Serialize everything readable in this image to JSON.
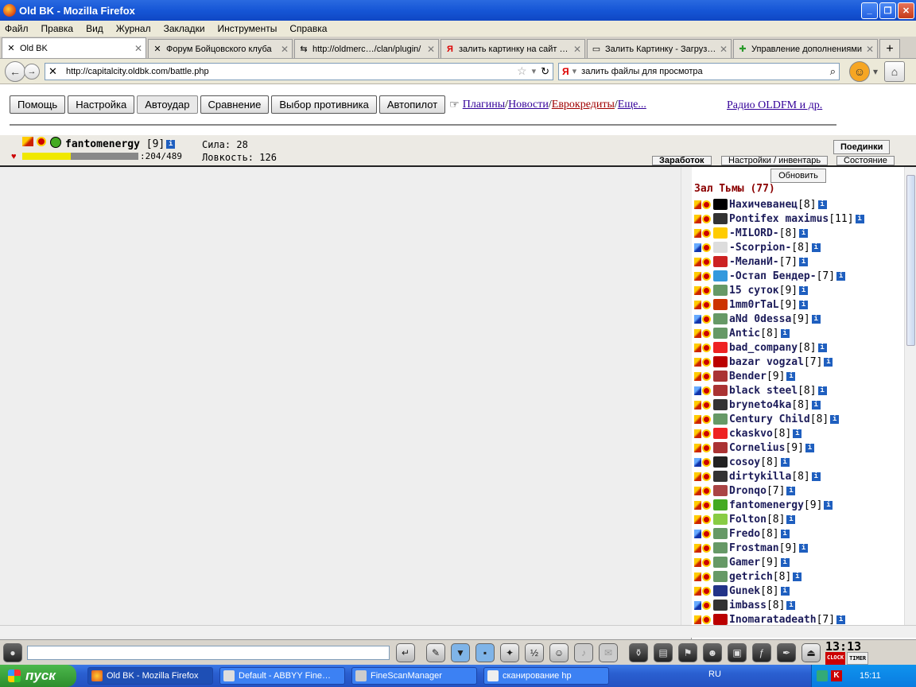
{
  "window": {
    "title": "Old BK - Mozilla Firefox"
  },
  "menu": [
    "Файл",
    "Правка",
    "Вид",
    "Журнал",
    "Закладки",
    "Инструменты",
    "Справка"
  ],
  "tabs": [
    {
      "label": "Old BK",
      "icon": "✕",
      "active": true
    },
    {
      "label": "Форум Бойцовского клуба",
      "icon": "✕",
      "active": false
    },
    {
      "label": "http://oldmerc…/clan/plugin/",
      "icon": "⇆",
      "active": false
    },
    {
      "label": "залить картинку на сайт …",
      "icon": "Я",
      "active": false
    },
    {
      "label": "Залить Картинку - Загруз…",
      "icon": "▭",
      "active": false
    },
    {
      "label": "Управление дополнениями",
      "icon": "✚",
      "active": false
    }
  ],
  "nav": {
    "url": "http://capitalcity.oldbk.com/battle.php",
    "search_value": "залить файлы для просмотра",
    "search_engine": "Я"
  },
  "game": {
    "buttons": [
      "Помощь",
      "Настройка",
      "Автоудар",
      "Сравнение",
      "Выбор противника",
      "Автопилот"
    ],
    "pressed_button": "Автоудар",
    "links": [
      "Плагины",
      "Новости",
      "Еврокредиты",
      "Еще..."
    ],
    "radio": "Радио OLDFM и др.",
    "player": {
      "nick": "fantomenergy",
      "level": "[9]",
      "hp": ":204/489",
      "hp_fraction": 0.42,
      "str": "Сила: 28",
      "agi": "Ловкость: 126"
    },
    "side_buttons": [
      "Поединки",
      "Заработок",
      "Настройки / инвентарь",
      "Состояние"
    ],
    "refresh": "Обновить",
    "room": "Зал Тьмы (77)",
    "users": [
      {
        "name": "Нахичеванец",
        "lvl": "[8]",
        "clan": "#000000"
      },
      {
        "name": "Pontifex maximus",
        "lvl": "[11]",
        "clan": "#333333"
      },
      {
        "name": "-MILORD-",
        "lvl": "[8]",
        "clan": "#ffcc00"
      },
      {
        "name": "-Scorpion-",
        "lvl": "[8]",
        "clan": "#dddddd"
      },
      {
        "name": "-МеланИ-",
        "lvl": "[7]",
        "clan": "#cc2222"
      },
      {
        "name": "-Остап Бендер-",
        "lvl": "[7]",
        "clan": "#3399dd"
      },
      {
        "name": "15 суток",
        "lvl": "[9]",
        "clan": "#669966"
      },
      {
        "name": "1mm0rTaL",
        "lvl": "[9]",
        "clan": "#cc3300"
      },
      {
        "name": "aNd 0dessa",
        "lvl": "[9]",
        "clan": "#669966"
      },
      {
        "name": "Antic",
        "lvl": "[8]",
        "clan": "#669966"
      },
      {
        "name": "bad_company",
        "lvl": "[8]",
        "clan": "#ee2222"
      },
      {
        "name": "bazar vogzal",
        "lvl": "[7]",
        "clan": "#bb0000"
      },
      {
        "name": "Bender",
        "lvl": "[9]",
        "clan": "#aa3333"
      },
      {
        "name": "black steel",
        "lvl": "[8]",
        "clan": "#aa3333"
      },
      {
        "name": "bryneto4ka",
        "lvl": "[8]",
        "clan": "#333333"
      },
      {
        "name": "Century Child",
        "lvl": "[8]",
        "clan": "#669966"
      },
      {
        "name": "ckaskvo",
        "lvl": "[8]",
        "clan": "#ee2222"
      },
      {
        "name": "Cornelius",
        "lvl": "[9]",
        "clan": "#aa3333"
      },
      {
        "name": "cosoy",
        "lvl": "[8]",
        "clan": "#222222"
      },
      {
        "name": "dirtykilla",
        "lvl": "[8]",
        "clan": "#333333"
      },
      {
        "name": "Dronqo",
        "lvl": "[7]",
        "clan": "#aa4444"
      },
      {
        "name": "fantomenergy",
        "lvl": "[9]",
        "clan": "#44aa22"
      },
      {
        "name": "Folton",
        "lvl": "[8]",
        "clan": "#88cc44"
      },
      {
        "name": "Fredo",
        "lvl": "[8]",
        "clan": "#669966"
      },
      {
        "name": "Frostman",
        "lvl": "[9]",
        "clan": "#669966"
      },
      {
        "name": "Gamer",
        "lvl": "[9]",
        "clan": "#669966"
      },
      {
        "name": "getrich",
        "lvl": "[8]",
        "clan": "#669966"
      },
      {
        "name": "Gunek",
        "lvl": "[8]",
        "clan": "#223388"
      },
      {
        "name": "imbass",
        "lvl": "[8]",
        "clan": "#333333"
      },
      {
        "name": "Inomaratadeath",
        "lvl": "[7]",
        "clan": "#bb0000"
      }
    ],
    "chat_placeholder": "",
    "clock": "13:13",
    "clock_tags": [
      "CLOCK",
      "TIMER"
    ]
  },
  "taskbar": {
    "start": "пуск",
    "tasks": [
      "Old BK - Mozilla Firefox",
      "Default - ABBYY Fine…",
      "FineScanManager",
      "сканирование hp"
    ],
    "lang": "RU",
    "time": "15:11"
  }
}
